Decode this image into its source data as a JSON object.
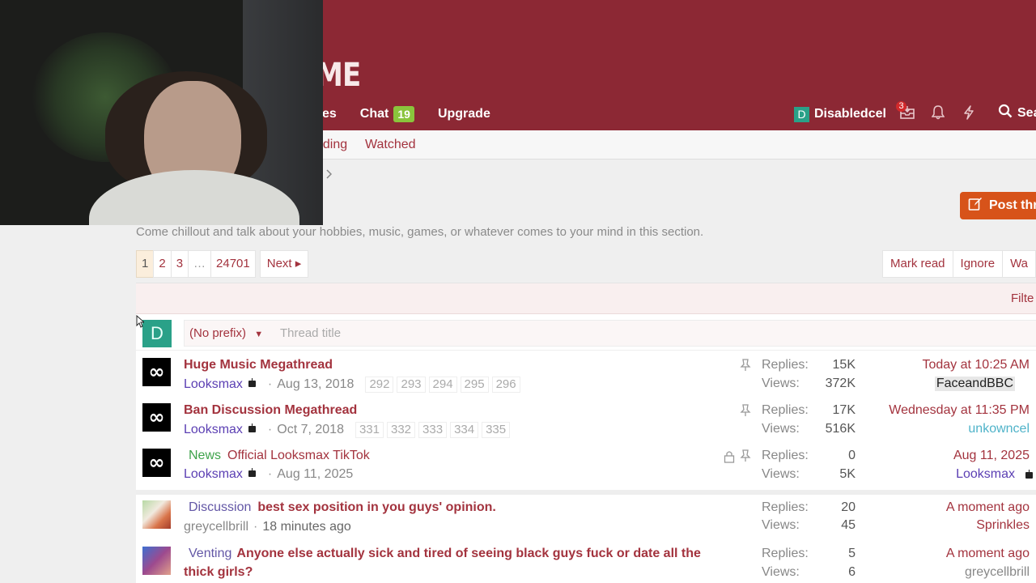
{
  "header": {
    "logo_text": "ME",
    "nav": [
      {
        "label": "es"
      },
      {
        "label": "Chat",
        "badge": "19"
      },
      {
        "label": "Upgrade"
      }
    ],
    "user": {
      "avatar_letter": "D",
      "name": "Disabledcel"
    },
    "inbox_count": "3",
    "search_label": "Sea"
  },
  "subnav": {
    "items": [
      "nding",
      "Watched"
    ]
  },
  "post_button": "Post thr",
  "description": "Come chillout and talk about your hobbies, music, games, or whatever comes to your mind in this section.",
  "pagination": {
    "pages": [
      "1",
      "2",
      "3",
      "…",
      "24701"
    ],
    "next": "Next ▸"
  },
  "actions": {
    "mark_read": "Mark read",
    "ignore": "Ignore",
    "watch": "Wa"
  },
  "filters_label": "Filte",
  "quick_thread": {
    "avatar_letter": "D",
    "prefix": "(No prefix)",
    "title_placeholder": "Thread title"
  },
  "threads": [
    {
      "title": "Huge Music Megathread",
      "author": "Looksmax",
      "date": "Aug 13, 2018",
      "pages": [
        "292",
        "293",
        "294",
        "295",
        "296"
      ],
      "replies_label": "Replies:",
      "replies": "15K",
      "views_label": "Views:",
      "views": "372K",
      "last_date": "Today at 10:25 AM",
      "last_user": "FaceandBBC"
    },
    {
      "title": "Ban Discussion Megathread",
      "author": "Looksmax",
      "date": "Oct 7, 2018",
      "pages": [
        "331",
        "332",
        "333",
        "334",
        "335"
      ],
      "replies_label": "Replies:",
      "replies": "17K",
      "views_label": "Views:",
      "views": "516K",
      "last_date": "Wednesday at 11:35 PM",
      "last_user": "unkowncel"
    },
    {
      "prefix": "News",
      "title": "Official Looksmax TikTok",
      "author": "Looksmax",
      "date": "Aug 11, 2025",
      "replies_label": "Replies:",
      "replies": "0",
      "views_label": "Views:",
      "views": "5K",
      "last_date": "Aug 11, 2025",
      "last_user": "Looksmax"
    },
    {
      "prefix": "Discussion",
      "title": "best sex position in you guys' opinion.",
      "author": "greycellbrill",
      "date": "18 minutes ago",
      "replies_label": "Replies:",
      "replies": "20",
      "views_label": "Views:",
      "views": "45",
      "last_date": "A moment ago",
      "last_user": "Sprinkles"
    },
    {
      "prefix": "Venting",
      "title": "Anyone else actually sick and tired of seeing black guys fuck or date all the",
      "title2": "thick girls?",
      "replies_label": "Replies:",
      "replies": "5",
      "views_label": "Views:",
      "views": "6",
      "last_date": "A moment ago",
      "last_user": "greycellbrill"
    }
  ],
  "colors": {
    "header": "#8c2834",
    "link": "#a3333e",
    "accent": "#d7531a"
  }
}
